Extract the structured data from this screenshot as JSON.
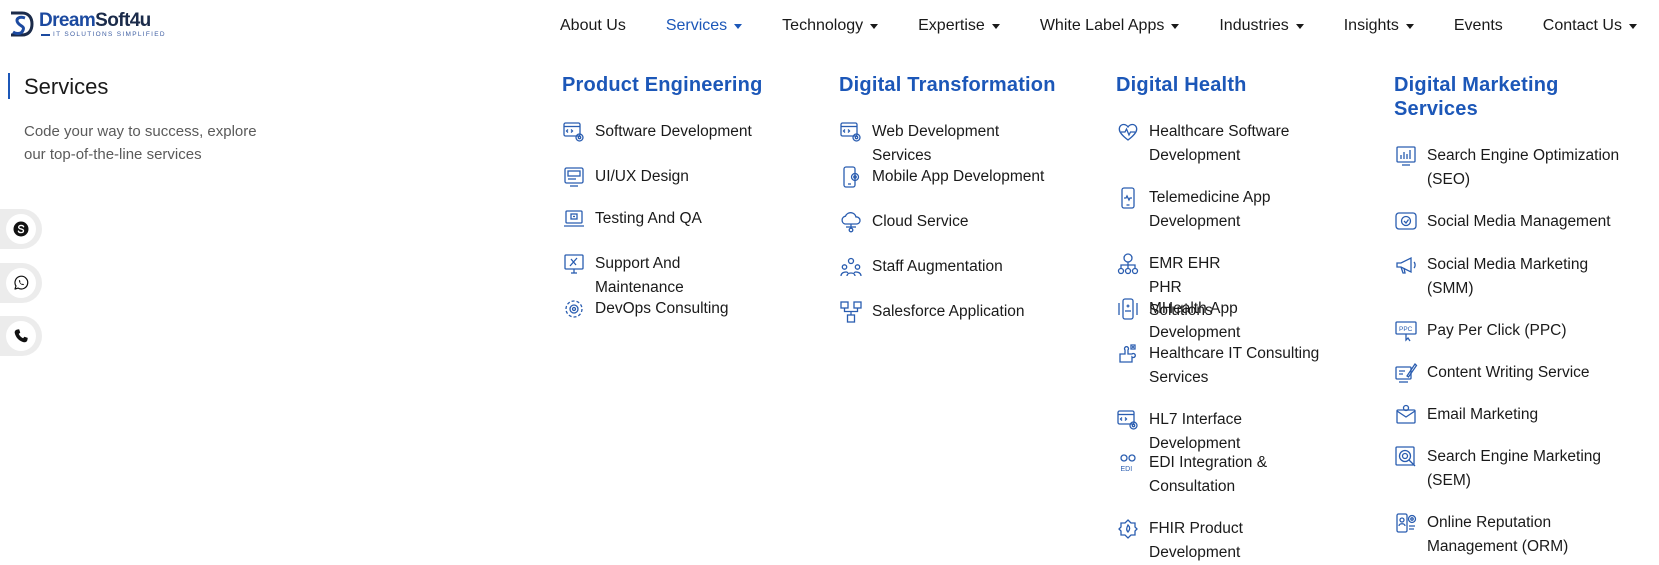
{
  "brand": {
    "name_part1": "Dream",
    "name_part2": "Soft4u",
    "tagline": "IT SOLUTIONS SIMPLIFIED"
  },
  "nav": [
    {
      "label": "About Us",
      "dropdown": false,
      "active": false
    },
    {
      "label": "Services",
      "dropdown": true,
      "active": true
    },
    {
      "label": "Technology",
      "dropdown": true,
      "active": false
    },
    {
      "label": "Expertise",
      "dropdown": true,
      "active": false
    },
    {
      "label": "White Label Apps",
      "dropdown": true,
      "active": false
    },
    {
      "label": "Industries",
      "dropdown": true,
      "active": false
    },
    {
      "label": "Insights",
      "dropdown": true,
      "active": false
    },
    {
      "label": "Events",
      "dropdown": false,
      "active": false
    },
    {
      "label": "Contact Us",
      "dropdown": true,
      "active": false
    }
  ],
  "intro": {
    "title": "Services",
    "description": "Code your way to success, explore our top-of-the-line services"
  },
  "contact_icons": [
    "skype-icon",
    "whatsapp-icon",
    "phone-icon"
  ],
  "colors": {
    "accent": "#1c57b8",
    "brand_dark": "#1b2b4a",
    "icon_stroke": "#2a5db0",
    "muted_text": "#5a5a5a"
  },
  "menu": {
    "product_engineering": {
      "title": "Product Engineering",
      "items": [
        {
          "label": "Software Development",
          "icon": "code-window-gear-icon"
        },
        {
          "label": "UI/UX Design",
          "icon": "ui-design-icon"
        },
        {
          "label": "Testing And QA",
          "icon": "laptop-test-icon"
        },
        {
          "label": "Support And Maintenance",
          "icon": "monitor-tools-icon"
        },
        {
          "label": "DevOps Consulting",
          "icon": "gears-icon"
        }
      ]
    },
    "digital_transformation": {
      "title": "Digital Transformation",
      "items": [
        {
          "label": "Web Development Services",
          "icon": "code-window-gear-icon"
        },
        {
          "label": "Mobile App Development",
          "icon": "mobile-gear-icon"
        },
        {
          "label": "Cloud Service",
          "icon": "cloud-network-icon"
        },
        {
          "label": "Staff Augmentation",
          "icon": "team-icon"
        },
        {
          "label": "Salesforce Application",
          "icon": "hierarchy-icon"
        }
      ]
    },
    "digital_health": {
      "title": "Digital Health",
      "items": [
        {
          "label": "Healthcare Software Development",
          "icon": "heart-pulse-icon"
        },
        {
          "label": "Telemedicine App Development",
          "icon": "phone-pulse-icon"
        },
        {
          "label": "EMR EHR PHR Solutions",
          "icon": "records-network-icon"
        },
        {
          "label": "MHealth App Development",
          "icon": "mobile-health-icon"
        },
        {
          "label": "Healthcare IT Consulting Services",
          "icon": "puzzle-health-icon"
        },
        {
          "label": "HL7 Interface Development",
          "icon": "code-window-gear-icon"
        },
        {
          "label": "EDI Integration & Consultation",
          "icon": "edi-icon"
        },
        {
          "label": "FHIR Product Development",
          "icon": "fire-badge-icon"
        }
      ]
    },
    "digital_marketing": {
      "title": "Digital Marketing Services",
      "items": [
        {
          "label": "Search Engine Optimization (SEO)",
          "icon": "seo-chart-icon"
        },
        {
          "label": "Social Media Management",
          "icon": "social-bubble-icon"
        },
        {
          "label": "Social Media Marketing (SMM)",
          "icon": "megaphone-icon"
        },
        {
          "label": "Pay Per Click (PPC)",
          "icon": "ppc-click-icon"
        },
        {
          "label": "Content Writing Service",
          "icon": "pen-document-icon"
        },
        {
          "label": "Email Marketing",
          "icon": "email-icon"
        },
        {
          "label": "Search Engine Marketing (SEM)",
          "icon": "target-search-icon"
        },
        {
          "label": "Online Reputation Management (ORM)",
          "icon": "reputation-icon"
        }
      ]
    }
  }
}
